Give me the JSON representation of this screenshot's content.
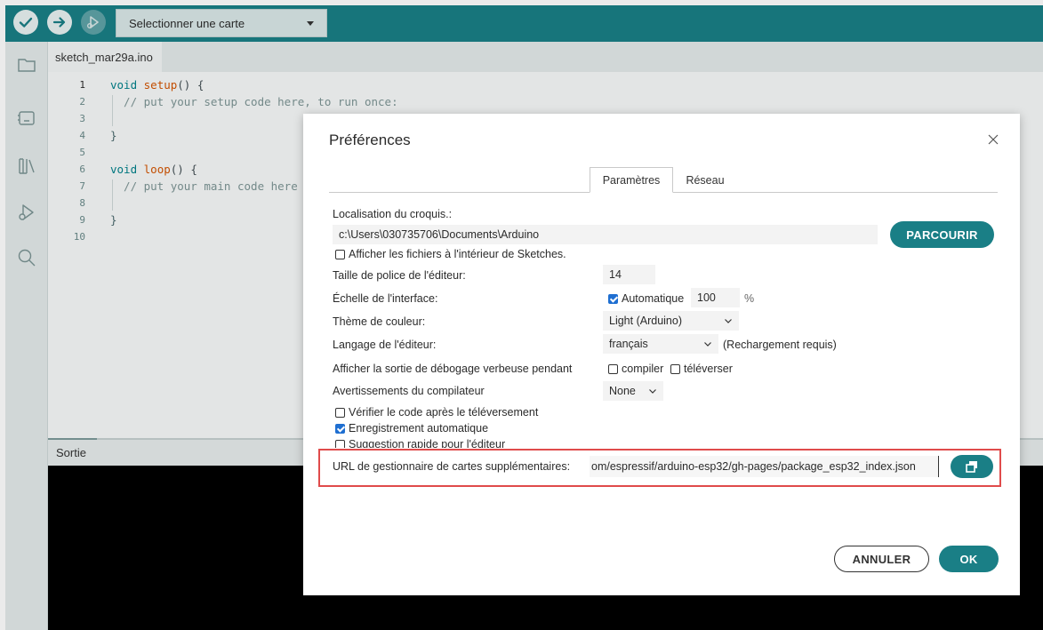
{
  "toolbar": {
    "board_select_label": "Selectionner une carte",
    "verify_icon": "check-icon",
    "upload_icon": "arrow-right-icon",
    "debug_icon": "debug-icon"
  },
  "sidebar": {
    "icons": [
      "folder-icon",
      "boards-manager-icon",
      "library-icon",
      "debug-icon",
      "search-icon"
    ]
  },
  "editor": {
    "file_tab": "sketch_mar29a.ino",
    "line_numbers": [
      "1",
      "2",
      "3",
      "4",
      "5",
      "6",
      "7",
      "8",
      "9",
      "10"
    ],
    "lines": [
      "void setup() {",
      "  // put your setup code here, to run once:",
      "",
      "}",
      "",
      "void loop() {",
      "  // put your main code here",
      "",
      "}",
      ""
    ]
  },
  "output": {
    "label": "Sortie"
  },
  "dialog": {
    "title": "Préférences",
    "tabs": [
      "Paramètres",
      "Réseau"
    ],
    "sketchbook_label": "Localisation du croquis.:",
    "sketchbook_path": "c:\\Users\\030735706\\Documents\\Arduino",
    "browse_button": "PARCOURIR",
    "show_sketch_files_label": "Afficher les fichiers à l'intérieur de Sketches.",
    "font_size_label": "Taille de police de l'éditeur:",
    "font_size_value": "14",
    "scale_label": "Échelle de l'interface:",
    "scale_auto_label": "Automatique",
    "scale_value": "100",
    "scale_unit": "%",
    "theme_label": "Thème de couleur:",
    "theme_value": "Light (Arduino)",
    "language_label": "Langage de l'éditeur:",
    "language_value": "français",
    "language_note": "(Rechargement requis)",
    "verbose_label": "Afficher la sortie de débogage verbeuse pendant",
    "verbose_compile": "compiler",
    "verbose_upload": "téléverser",
    "warnings_label": "Avertissements du compilateur",
    "warnings_value": "None",
    "verify_after_upload": "Vérifier le code après le téléversement",
    "autosave": "Enregistrement automatique",
    "quick_suggest": "Suggestion rapide pour l'éditeur",
    "board_urls_label": "URL de gestionnaire de cartes supplémentaires:",
    "board_urls_value": "om/espressif/arduino-esp32/gh-pages/package_esp32_index.json",
    "cancel_button": "ANNULER",
    "ok_button": "OK",
    "highlight_color": "#e04b4b",
    "accent_color": "#1a7f86"
  }
}
